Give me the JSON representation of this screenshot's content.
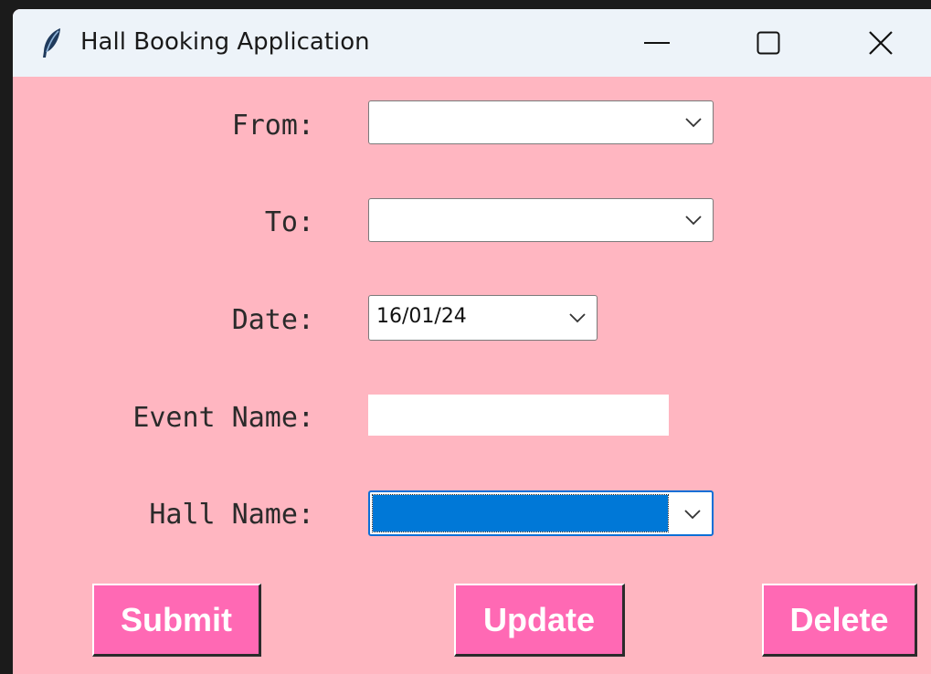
{
  "window": {
    "title": "Hall Booking Application",
    "background": "#ffb6c1",
    "controls": {
      "minimize_icon": "minimize-icon",
      "maximize_icon": "maximize-icon",
      "close_icon": "close-icon"
    }
  },
  "form": {
    "from": {
      "label": "From:",
      "value": ""
    },
    "to": {
      "label": "To:",
      "value": ""
    },
    "date": {
      "label": "Date:",
      "value": "16/01/24"
    },
    "event_name": {
      "label": "Event Name:",
      "value": ""
    },
    "hall_name": {
      "label": "Hall Name:",
      "value": ""
    }
  },
  "buttons": {
    "submit": "Submit",
    "update": "Update",
    "delete": "Delete",
    "color": "#ff69b4"
  },
  "colors": {
    "selection": "#0078d7",
    "focus_border": "#0b6fd6"
  }
}
